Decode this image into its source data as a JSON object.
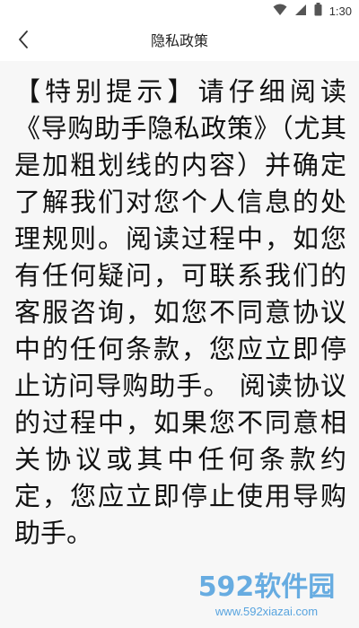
{
  "status_bar": {
    "time": "1:30",
    "icons": [
      "wifi-icon",
      "signal-icon",
      "battery-icon"
    ]
  },
  "nav": {
    "title": "隐私政策",
    "back_icon": "chevron-left-icon"
  },
  "content": {
    "paragraph": "【特别提示】请仔细阅读《导购助手隐私政策》（尤其是加粗划线的内容）并确定了解我们对您个人信息的处理规则。阅读过程中，如您有任何疑问，可联系我们的客服咨询，如您不同意协议中的任何条款，您应立即停止访问导购助手。 阅读协议的过程中，如果您不同意相关协议或其中任何条款约定，您应立即停止使用导购助手。"
  },
  "watermark": {
    "brand": "592软件园",
    "url": "www.592xiazai.com",
    "colors": {
      "primary": "#2f8fd8",
      "accent": "#5fb6f0"
    }
  }
}
